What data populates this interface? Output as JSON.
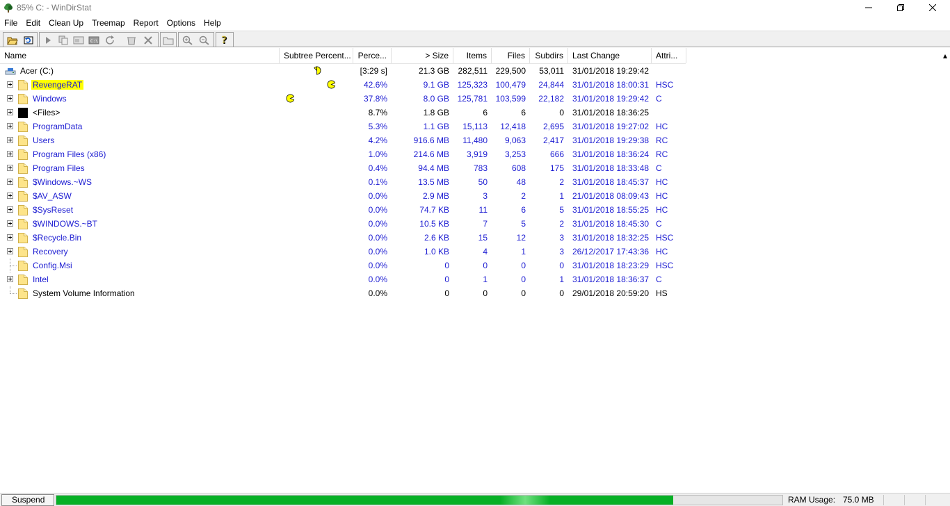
{
  "window": {
    "title": "85% C: - WinDirStat"
  },
  "menu": [
    "File",
    "Edit",
    "Clean Up",
    "Treemap",
    "Report",
    "Options",
    "Help"
  ],
  "toolbar": {
    "buttons": [
      "open-icon",
      "refresh-icon",
      "play-icon",
      "copy-path-icon",
      "explorer-icon",
      "command-prompt-icon",
      "refresh-selected-icon",
      "recycle-bin-icon",
      "delete-icon",
      "new-folder-icon",
      "zoom-in-icon",
      "zoom-out-icon",
      "help-icon"
    ]
  },
  "columns": [
    "Name",
    "Subtree Percent...",
    "Perce...",
    "> Size",
    "Items",
    "Files",
    "Subdirs",
    "Last Change",
    "Attri..."
  ],
  "root": {
    "name": "Acer (C:)",
    "subtree_percent": 100,
    "percent": "[3:29 s]",
    "size": "21.3 GB",
    "items": "282,511",
    "files": "229,500",
    "subdirs": "53,011",
    "last_change": "31/01/2018  19:29:42",
    "attributes": ""
  },
  "rows": [
    {
      "name": "RevengeRAT",
      "expandable": true,
      "highlighted": true,
      "subtree_percent": 42.6,
      "percent": "42.6%",
      "size": "9.1 GB",
      "items": "125,323",
      "files": "100,479",
      "subdirs": "24,844",
      "last_change": "31/01/2018  18:00:31",
      "attributes": "HSC",
      "color": "#1c1cd2",
      "icon": "folder-icon"
    },
    {
      "name": "Windows",
      "expandable": true,
      "subtree_percent": 37.8,
      "percent": "37.8%",
      "size": "8.0 GB",
      "items": "125,781",
      "files": "103,599",
      "subdirs": "22,182",
      "last_change": "31/01/2018  19:29:42",
      "attributes": "C",
      "color": "#1c1cd2",
      "icon": "folder-icon"
    },
    {
      "name": "<Files>",
      "expandable": true,
      "percent": "8.7%",
      "size": "1.8 GB",
      "items": "6",
      "files": "6",
      "subdirs": "0",
      "last_change": "31/01/2018  18:36:25",
      "attributes": "",
      "color": "#000000",
      "icon": "files-icon"
    },
    {
      "name": "ProgramData",
      "expandable": true,
      "percent": "5.3%",
      "size": "1.1 GB",
      "items": "15,113",
      "files": "12,418",
      "subdirs": "2,695",
      "last_change": "31/01/2018  19:27:02",
      "attributes": "HC",
      "color": "#1c1cd2",
      "icon": "folder-icon"
    },
    {
      "name": "Users",
      "expandable": true,
      "percent": "4.2%",
      "size": "916.6 MB",
      "items": "11,480",
      "files": "9,063",
      "subdirs": "2,417",
      "last_change": "31/01/2018  19:29:38",
      "attributes": "RC",
      "color": "#1c1cd2",
      "icon": "folder-icon"
    },
    {
      "name": "Program Files (x86)",
      "expandable": true,
      "percent": "1.0%",
      "size": "214.6 MB",
      "items": "3,919",
      "files": "3,253",
      "subdirs": "666",
      "last_change": "31/01/2018  18:36:24",
      "attributes": "RC",
      "color": "#1c1cd2",
      "icon": "folder-icon"
    },
    {
      "name": "Program Files",
      "expandable": true,
      "percent": "0.4%",
      "size": "94.4 MB",
      "items": "783",
      "files": "608",
      "subdirs": "175",
      "last_change": "31/01/2018  18:33:48",
      "attributes": "C",
      "color": "#1c1cd2",
      "icon": "folder-icon"
    },
    {
      "name": "$Windows.~WS",
      "expandable": true,
      "percent": "0.1%",
      "size": "13.5 MB",
      "items": "50",
      "files": "48",
      "subdirs": "2",
      "last_change": "31/01/2018  18:45:37",
      "attributes": "HC",
      "color": "#1c1cd2",
      "icon": "folder-icon"
    },
    {
      "name": "$AV_ASW",
      "expandable": true,
      "percent": "0.0%",
      "size": "2.9 MB",
      "items": "3",
      "files": "2",
      "subdirs": "1",
      "last_change": "21/01/2018  08:09:43",
      "attributes": "HC",
      "color": "#1c1cd2",
      "icon": "folder-icon"
    },
    {
      "name": "$SysReset",
      "expandable": true,
      "percent": "0.0%",
      "size": "74.7 KB",
      "items": "11",
      "files": "6",
      "subdirs": "5",
      "last_change": "31/01/2018  18:55:25",
      "attributes": "HC",
      "color": "#1c1cd2",
      "icon": "folder-icon"
    },
    {
      "name": "$WINDOWS.~BT",
      "expandable": true,
      "percent": "0.0%",
      "size": "10.5 KB",
      "items": "7",
      "files": "5",
      "subdirs": "2",
      "last_change": "31/01/2018  18:45:30",
      "attributes": "C",
      "color": "#1c1cd2",
      "icon": "folder-icon"
    },
    {
      "name": "$Recycle.Bin",
      "expandable": true,
      "percent": "0.0%",
      "size": "2.6 KB",
      "items": "15",
      "files": "12",
      "subdirs": "3",
      "last_change": "31/01/2018  18:32:25",
      "attributes": "HSC",
      "color": "#1c1cd2",
      "icon": "folder-icon"
    },
    {
      "name": "Recovery",
      "expandable": true,
      "percent": "0.0%",
      "size": "1.0 KB",
      "items": "4",
      "files": "1",
      "subdirs": "3",
      "last_change": "26/12/2017  17:43:36",
      "attributes": "HC",
      "color": "#1c1cd2",
      "icon": "folder-icon"
    },
    {
      "name": "Config.Msi",
      "expandable": false,
      "percent": "0.0%",
      "size": "0",
      "items": "0",
      "files": "0",
      "subdirs": "0",
      "last_change": "31/01/2018  18:23:29",
      "attributes": "HSC",
      "color": "#1c1cd2",
      "icon": "folder-icon"
    },
    {
      "name": "Intel",
      "expandable": true,
      "percent": "0.0%",
      "size": "0",
      "items": "1",
      "files": "0",
      "subdirs": "1",
      "last_change": "31/01/2018  18:36:37",
      "attributes": "C",
      "color": "#1c1cd2",
      "icon": "folder-icon"
    },
    {
      "name": "System Volume Information",
      "expandable": false,
      "percent": "0.0%",
      "size": "0",
      "items": "0",
      "files": "0",
      "subdirs": "0",
      "last_change": "29/01/2018  20:59:20",
      "attributes": "HS",
      "color": "#000000",
      "icon": "folder-icon"
    }
  ],
  "status": {
    "suspend_label": "Suspend",
    "progress": 0.85,
    "ram_label": "RAM Usage:",
    "ram_value": "75.0 MB"
  },
  "colors": {
    "link_blue": "#1c1cd2",
    "progress_green": "#06b025",
    "highlight": "#ffff00",
    "pacman": "#ffff00"
  }
}
